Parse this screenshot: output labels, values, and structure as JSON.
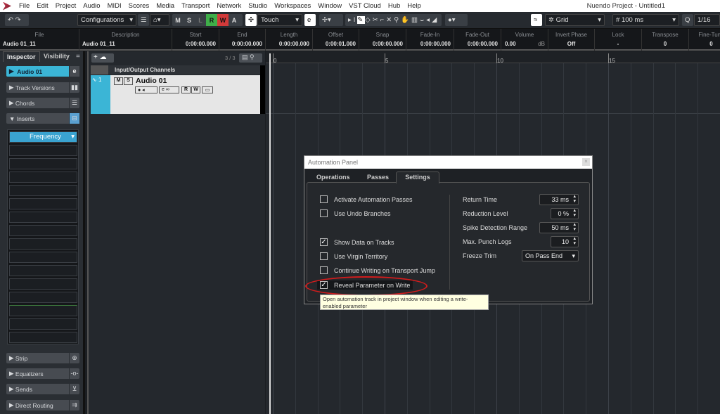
{
  "menubar": {
    "items": [
      "File",
      "Edit",
      "Project",
      "Audio",
      "MIDI",
      "Scores",
      "Media",
      "Transport",
      "Network",
      "Studio",
      "Workspaces",
      "Window",
      "VST Cloud",
      "Hub",
      "Help"
    ],
    "title": "Nuendo Project - Untitled1"
  },
  "toolbar": {
    "configurations": "Configurations",
    "m": "M",
    "s": "S",
    "l": "L",
    "r": "R",
    "w": "W",
    "a": "A",
    "automation_mode": "Touch",
    "snap_type": "Grid",
    "grid": "100 ms",
    "quantize_label": "Q",
    "quantize": "1/16",
    "colors": {
      "read": "#3fae49",
      "write": "#d23a3a"
    }
  },
  "infoline": [
    {
      "h": "File",
      "v": "Audio 01_11"
    },
    {
      "h": "Description",
      "v": "Audio 01_11"
    },
    {
      "h": "Start",
      "v": "0:00:00.000"
    },
    {
      "h": "End",
      "v": "0:00:00.000"
    },
    {
      "h": "Length",
      "v": "0:00:00.000"
    },
    {
      "h": "Offset",
      "v": "0:00:01.000"
    },
    {
      "h": "Snap",
      "v": "0:00:00.000"
    },
    {
      "h": "Fade-In",
      "v": "0:00:00.000"
    },
    {
      "h": "Fade-Out",
      "v": "0:00:00.000"
    },
    {
      "h": "Volume",
      "v": "0.00",
      "unit": "dB"
    },
    {
      "h": "Invert Phase",
      "v": "Off"
    },
    {
      "h": "Lock",
      "v": "-"
    },
    {
      "h": "Transpose",
      "v": "0"
    },
    {
      "h": "Fine-Tune",
      "v": "0"
    }
  ],
  "inspector": {
    "tabs": [
      "Inspector",
      "Visibility"
    ],
    "track": "Audio 01",
    "sections": [
      "Track Versions",
      "Chords",
      "Inserts"
    ],
    "insert": "Frequency",
    "bottom": [
      "Strip",
      "Equalizers",
      "Sends",
      "Direct Routing"
    ]
  },
  "tracklist": {
    "count": "3 / 3",
    "folder": "Input/Output Channels",
    "track_number": "1",
    "track_name": "Audio 01",
    "m": "M",
    "s": "S",
    "r": "R",
    "w": "W"
  },
  "ruler": {
    "ticks": [
      "0",
      "5",
      "10",
      "15"
    ]
  },
  "dialog": {
    "title": "Automation Panel",
    "tabs": [
      "Operations",
      "Passes",
      "Settings"
    ],
    "active_tab": "Settings",
    "checks": [
      {
        "label": "Activate Automation Passes",
        "checked": false
      },
      {
        "label": "Use Undo Branches",
        "checked": false
      },
      {
        "label": "Show Data on Tracks",
        "checked": true
      },
      {
        "label": "Use Virgin Territory",
        "checked": false
      },
      {
        "label": "Continue Writing on Transport Jump",
        "checked": false
      },
      {
        "label": "Reveal Parameter on Write",
        "checked": true
      }
    ],
    "params": [
      {
        "label": "Return Time",
        "value": "33 ms"
      },
      {
        "label": "Reduction Level",
        "value": "0 %"
      },
      {
        "label": "Spike Detection Range",
        "value": "50 ms"
      },
      {
        "label": "Max. Punch Logs",
        "value": "10"
      },
      {
        "label": "Freeze Trim",
        "value": "On Pass End"
      }
    ],
    "tooltip": "Open automation track in project window when editing a write-enabled parameter"
  }
}
